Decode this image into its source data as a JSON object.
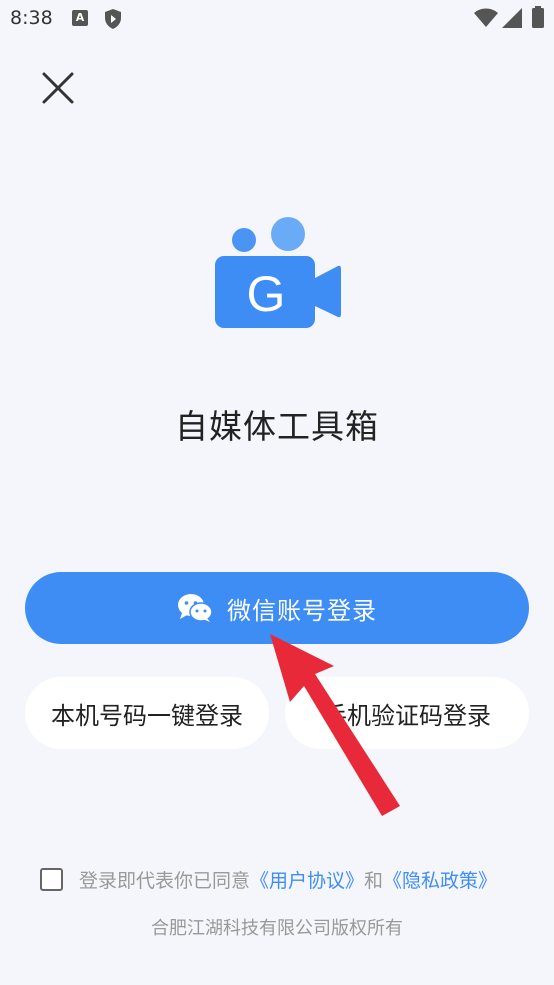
{
  "status_bar": {
    "time": "8:38",
    "notif_a": "A"
  },
  "app": {
    "title": "自媒体工具箱",
    "logo_letter": "G"
  },
  "buttons": {
    "wechat_login": "微信账号登录",
    "onekey_login": "本机号码一键登录",
    "sms_login": "手机验证码登录"
  },
  "agreement": {
    "prefix": "登录即代表你已同意",
    "user_agreement": "《用户协议》",
    "and": "和",
    "privacy_policy": "《隐私政策》"
  },
  "footer": {
    "copyright": "合肥江湖科技有限公司版权所有"
  },
  "colors": {
    "accent": "#3d8df5",
    "arrow": "#e8293a",
    "background": "#f4f6fb"
  }
}
